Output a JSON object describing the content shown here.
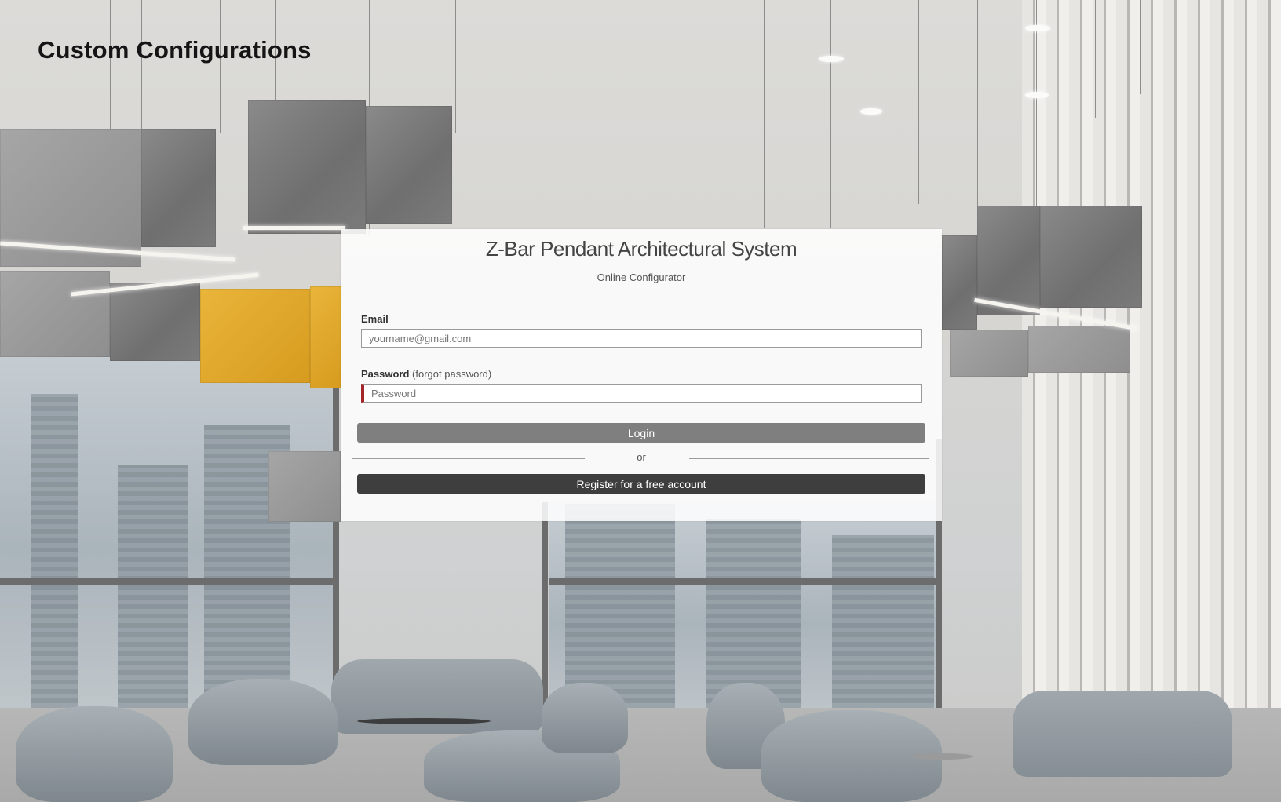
{
  "page": {
    "title": "Custom Configurations"
  },
  "login_card": {
    "title": "Z-Bar Pendant Architectural System",
    "subtitle": "Online Configurator",
    "email": {
      "label": "Email",
      "value": "",
      "placeholder": "yourname@gmail.com"
    },
    "password": {
      "label": "Password",
      "forgot_link": "(forgot password)",
      "value": "",
      "placeholder": "Password"
    },
    "login_button": "Login",
    "divider_text": "or",
    "register_button": "Register for a free account"
  },
  "colors": {
    "login_button": "#7f7f7f",
    "register_button": "#3e3e3e",
    "password_error_marker": "#a2272b",
    "panel_yellow": "#e0a82c"
  }
}
